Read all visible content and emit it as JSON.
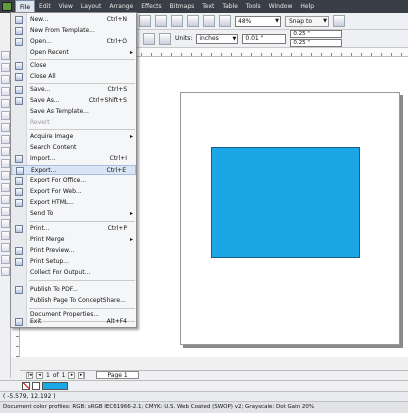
{
  "menubar": {
    "items": [
      "File",
      "Edit",
      "View",
      "Layout",
      "Arrange",
      "Effects",
      "Bitmaps",
      "Text",
      "Table",
      "Tools",
      "Window",
      "Help"
    ]
  },
  "toolbar": {
    "zoom": "48%",
    "snap_to": "Snap to",
    "units_label": "Units:",
    "units_value": "inches",
    "nudge": "0.01 \"",
    "dup_x": "0.25 \"",
    "dup_y": "0.25 \""
  },
  "file_menu": {
    "items": {
      "new": {
        "label": "New...",
        "shortcut": "Ctrl+N"
      },
      "new_from_template": {
        "label": "New From Template..."
      },
      "open": {
        "label": "Open...",
        "shortcut": "Ctrl+O"
      },
      "open_recent": {
        "label": "Open Recent"
      },
      "close": {
        "label": "Close"
      },
      "close_all": {
        "label": "Close All"
      },
      "save": {
        "label": "Save...",
        "shortcut": "Ctrl+S"
      },
      "save_as": {
        "label": "Save As...",
        "shortcut": "Ctrl+Shift+S"
      },
      "save_as_template": {
        "label": "Save As Template..."
      },
      "revert": {
        "label": "Revert"
      },
      "acquire_image": {
        "label": "Acquire Image"
      },
      "search_content": {
        "label": "Search Content"
      },
      "import": {
        "label": "Import...",
        "shortcut": "Ctrl+I"
      },
      "export": {
        "label": "Export...",
        "shortcut": "Ctrl+E"
      },
      "export_for_office": {
        "label": "Export For Office..."
      },
      "export_for_web": {
        "label": "Export For Web..."
      },
      "export_html": {
        "label": "Export HTML..."
      },
      "send_to": {
        "label": "Send To"
      },
      "print": {
        "label": "Print...",
        "shortcut": "Ctrl+P"
      },
      "print_merge": {
        "label": "Print Merge"
      },
      "print_preview": {
        "label": "Print Preview..."
      },
      "print_setup": {
        "label": "Print Setup..."
      },
      "collect_for_output": {
        "label": "Collect For Output..."
      },
      "publish_pdf": {
        "label": "Publish To PDF..."
      },
      "publish_conceptshare": {
        "label": "Publish Page To ConceptShare..."
      },
      "document_properties": {
        "label": "Document Properties..."
      },
      "exit": {
        "label": "Exit",
        "shortcut": "Alt+F4"
      }
    }
  },
  "navigator": {
    "page_position": "1",
    "of_label": "of",
    "page_count": "1",
    "page_tab": "Page 1"
  },
  "canvas": {
    "rectangle_fill": "#1ba7e6"
  },
  "palette": {
    "swatch_fill": "#1ba7e6"
  },
  "status": {
    "cursor": "( -5.579, 12.192 )",
    "color_profiles": "Document color profiles: RGB: sRGB IEC61966-2.1; CMYK: U.S. Web Coated (SWOP) v2; Grayscale: Dot Gain 20%"
  }
}
